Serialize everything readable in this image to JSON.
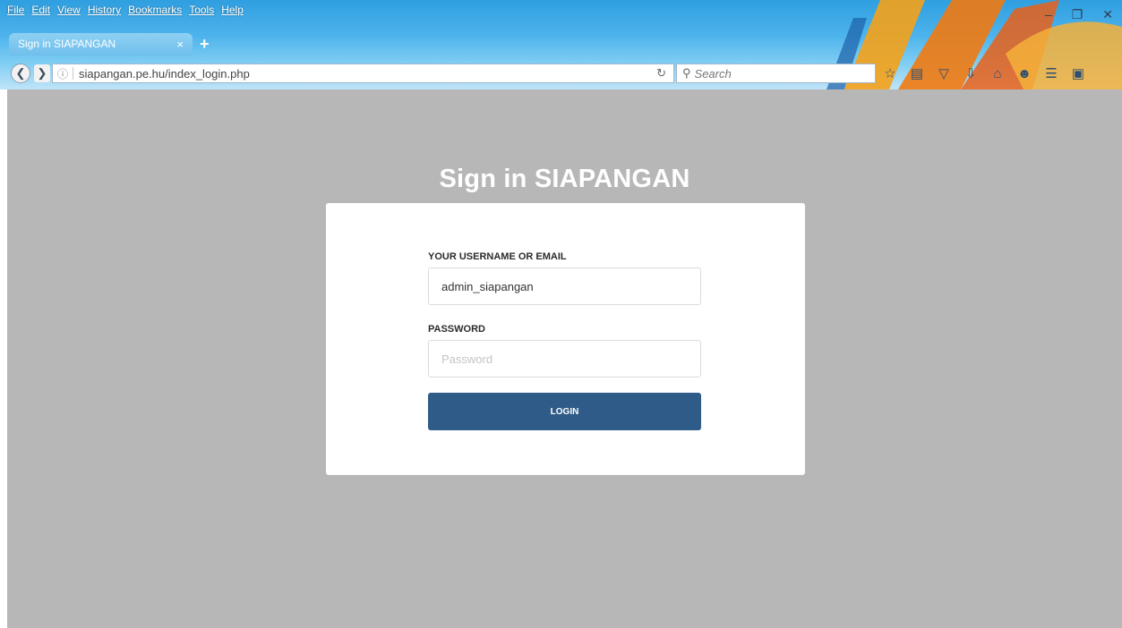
{
  "browser": {
    "menu_items": [
      "File",
      "Edit",
      "View",
      "History",
      "Bookmarks",
      "Tools",
      "Help"
    ],
    "tab": {
      "title": "Sign in SIAPANGAN",
      "close_glyph": "×",
      "new_tab_glyph": "+"
    },
    "url": "siapangan.pe.hu/index_login.php",
    "search_placeholder": "Search",
    "toolbar_icons": [
      "bookmark-star-icon",
      "reading-list-icon",
      "pocket-icon",
      "download-icon",
      "home-icon",
      "emoji-icon",
      "menu-icon",
      "extension-icon"
    ],
    "window_controls": [
      "minimize-icon",
      "restore-icon",
      "close-icon"
    ]
  },
  "page": {
    "title": "Sign in SIAPANGAN",
    "username_label": "YOUR USERNAME OR EMAIL",
    "username_value": "admin_siapangan",
    "password_label": "PASSWORD",
    "password_placeholder": "Password",
    "login_label": "LOGIN"
  },
  "colors": {
    "page_background": "#b7b7b7",
    "card_background": "#ffffff",
    "button": "#2e5b88"
  }
}
